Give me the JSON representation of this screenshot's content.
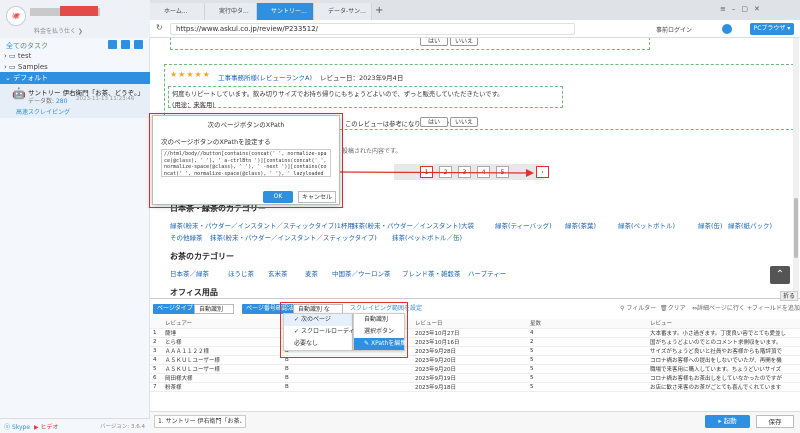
{
  "sidebar": {
    "tagline": "料金を払う仕く ❯",
    "all_tasks": "全てのタスク",
    "tree": [
      "test",
      "Samples"
    ],
    "default_folder": "デフォルト",
    "task": {
      "name": "サントリー 伊右衛門「お茶、どうぞ。」",
      "data_label": "データ数:",
      "data_count": "280",
      "date": "2023-11-13 11:23:46",
      "status": "高速スクレイピング"
    },
    "footer": {
      "skype": "Skype",
      "tutorial": "ヒデオ",
      "version": "バージョン: 3.6.4"
    }
  },
  "browser": {
    "tabs": [
      "ホーム...",
      "実行中タ...",
      "サントリー...",
      "データ-サン..."
    ],
    "url": "https://www.askul.co.jp/review/P233512/",
    "login": "事前ログイン",
    "pc_browser": "PCブラウザ ▾"
  },
  "webpage": {
    "stars": "★★★★★",
    "reviewer": "工事事務所様(レビューランクA)",
    "review_date": "レビュー日：2023年9月4日",
    "review_text": "何度もリピートしています。飲み切りサイズでお持ち帰りにもちょうどよいので、ずっと販売していただきたいです。",
    "review_use": "(用途：来客用)",
    "helpful_q": "このレビューは参考になりましたか?",
    "yes": "はい",
    "no": "いいえ",
    "posted_note": "投稿された内容です。",
    "pager": [
      "‹",
      "1",
      "2",
      "3",
      "4",
      "5",
      "›"
    ],
    "category1_title": "日本茶・緑茶のカテゴリー",
    "category1_links": [
      "緑茶(粉末・パウダー／インスタント／スティックタイプ)1杯用",
      "抹茶(粉末・パウダー／インスタント)大袋",
      "緑茶(ティーバッグ)",
      "緑茶(茶葉)",
      "緑茶(ペットボトル)",
      "緑茶(缶)",
      "緑茶(紙パック)",
      "その他緑茶",
      "抹茶(粉末・パウダー／インスタント／スティックタイプ)",
      "抹茶(ペットボトル／缶)"
    ],
    "category2_title": "お茶のカテゴリー",
    "category2_links": [
      "日本茶／緑茶",
      "ほうじ茶",
      "玄米茶",
      "麦茶",
      "中国茶／ウーロン茶",
      "ブレンド茶・雑穀茶",
      "ハーブティー"
    ],
    "office_title": "オフィス用品"
  },
  "dialog": {
    "title": "次のページボタンのXPath",
    "label": "次のページボタンのXPathを設定する",
    "xpath": "//html/body//button[contains(concat(' ', normalize-space(@class), ' '), ' a-ctrlBtn ')][contains(concat(' ', normalize-space(@class), ' '), ' -next ')][contains(concat(' ', normalize-space(@class), ' '), ' lazyloaded ')]",
    "ok": "OK",
    "cancel": "キャンセル"
  },
  "panel": {
    "page_type_label": "ページタイプ",
    "page_type_value": "自動識別",
    "paging_label": "ページ番号確認法",
    "paging_value": "自動識別 など...",
    "scroll_setting": "スクレイピング範囲を設定",
    "filter": "フィルター",
    "clear": "クリア",
    "detail": "詳細ページに行く",
    "add_field": "フィールドを追加",
    "collapse": "折る",
    "menu_left": [
      "次のページ",
      "スクロールローディング",
      "必要なし"
    ],
    "menu_right": [
      "自動識別",
      "選択ボタン",
      "XPathを編集"
    ],
    "columns": [
      "",
      "レビュアー",
      "",
      "レビュー日",
      "星数",
      "レビュー"
    ],
    "rows": [
      [
        "1",
        "薩埵",
        "",
        "2023年10月27日",
        "4",
        "大本番ます。小さ過ぎます。丁度良い容でとても愛並し"
      ],
      [
        "2",
        "とら様",
        "",
        "2023年10月16日",
        "2",
        "国がちょうどよいのでとのコメント求側収をいます。"
      ],
      [
        "3",
        "ＡＡＡ１１２２様",
        "B",
        "2023年9月28日",
        "5",
        "サイズがちょうど良いと社員やお客様からも階評頂で"
      ],
      [
        "4",
        "ＡＳＫＵＬユーザー様",
        "B",
        "2023年9月20日",
        "5",
        "コロナ禍お客様への提出をしないでいたが、再開を機"
      ],
      [
        "5",
        "ＡＳＫＵＬユーザー様",
        "B",
        "2023年9月20日",
        "5",
        "職場で来客用に購入しています。ちょうどいいサイズ"
      ],
      [
        "6",
        "岡田様大様",
        "B",
        "2023年9月19日",
        "5",
        "コロナ禍お客様もお茶出しをしていなかったのですが"
      ],
      [
        "7",
        "粉茶様",
        "B",
        "2023年9月18日",
        "5",
        "お店に歓さ来客のお茶がごとても喜んでくれています"
      ]
    ],
    "task_tab": "1. サントリー 伊右衛門「お茶、ど...",
    "run": "▸ 起動",
    "save": "保存"
  }
}
